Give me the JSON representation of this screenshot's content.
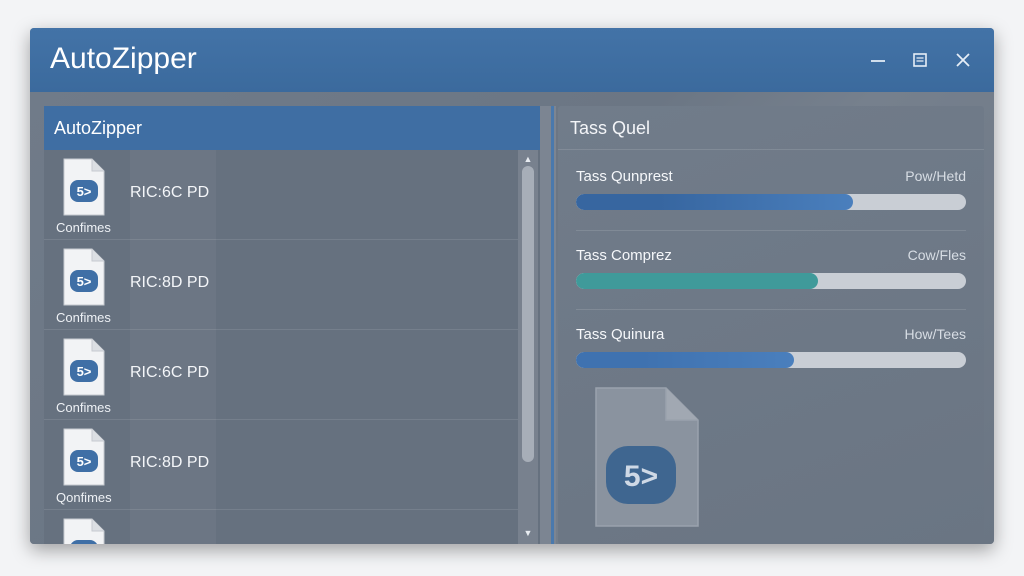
{
  "window": {
    "title": "AutoZipper",
    "controls": {
      "minimize_icon": "minimize-icon",
      "maximize_icon": "restore-icon",
      "close_icon": "close-icon"
    }
  },
  "left_panel": {
    "header": "AutoZipper",
    "files": [
      {
        "name": "RIC:6C PD",
        "status": "Confimes",
        "icon": "zip-file-icon"
      },
      {
        "name": "RIC:8D PD",
        "status": "Confimes",
        "icon": "zip-file-icon"
      },
      {
        "name": "RIC:6C PD",
        "status": "Confimes",
        "icon": "zip-file-icon"
      },
      {
        "name": "RIC:8D PD",
        "status": "Qonfimes",
        "icon": "zip-file-icon"
      }
    ]
  },
  "right_panel": {
    "header": "Tass Quel",
    "tasks": [
      {
        "name": "Tass Qunprest",
        "status": "Pow/Hetd",
        "progress": 0.71,
        "color": "#4a7fbd",
        "color_dark": "#3766a0"
      },
      {
        "name": "Tass Comprez",
        "status": "Cow/Fles",
        "progress": 0.62,
        "color": "#3f9a9a",
        "color_dark": "#3f9a9a"
      },
      {
        "name": "Tass Quinura",
        "status": "How/Tees",
        "progress": 0.56,
        "color": "#4a7fbd",
        "color_dark": "#3f72b0"
      }
    ]
  },
  "colors": {
    "titlebar": "#3f6ea3",
    "accent": "#4a7fbd",
    "teal": "#3f9a9a"
  }
}
